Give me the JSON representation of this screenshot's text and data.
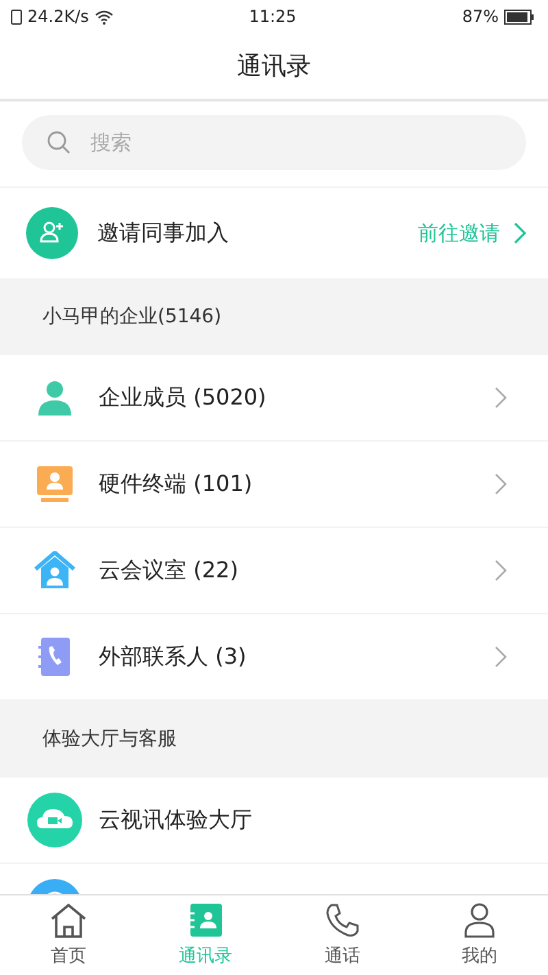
{
  "status_bar": {
    "speed": "24.2K/s",
    "time": "11:25",
    "battery": "87%"
  },
  "header": {
    "title": "通讯录"
  },
  "search": {
    "placeholder": "搜索"
  },
  "invite": {
    "label": "邀请同事加入",
    "action": "前往邀请"
  },
  "sections": [
    {
      "title": "小马甲的企业(5146)",
      "items": [
        {
          "kind": "member",
          "label": "企业成员 (5020)",
          "chevron": true
        },
        {
          "kind": "terminal",
          "label": "硬件终端 (101)",
          "chevron": true
        },
        {
          "kind": "room",
          "label": "云会议室 (22)",
          "chevron": true
        },
        {
          "kind": "external",
          "label": "外部联系人 (3)",
          "chevron": true
        }
      ]
    },
    {
      "title": "体验大厅与客服",
      "items": [
        {
          "kind": "hall",
          "label": "云视讯体验大厅",
          "chevron": false
        },
        {
          "kind": "service",
          "chevron": false
        }
      ]
    }
  ],
  "tabs": [
    {
      "kind": "home",
      "label": "首页",
      "selected": false
    },
    {
      "kind": "contacts",
      "label": "通讯录",
      "selected": true
    },
    {
      "kind": "call",
      "label": "通话",
      "selected": false
    },
    {
      "kind": "me",
      "label": "我的",
      "selected": false
    }
  ]
}
